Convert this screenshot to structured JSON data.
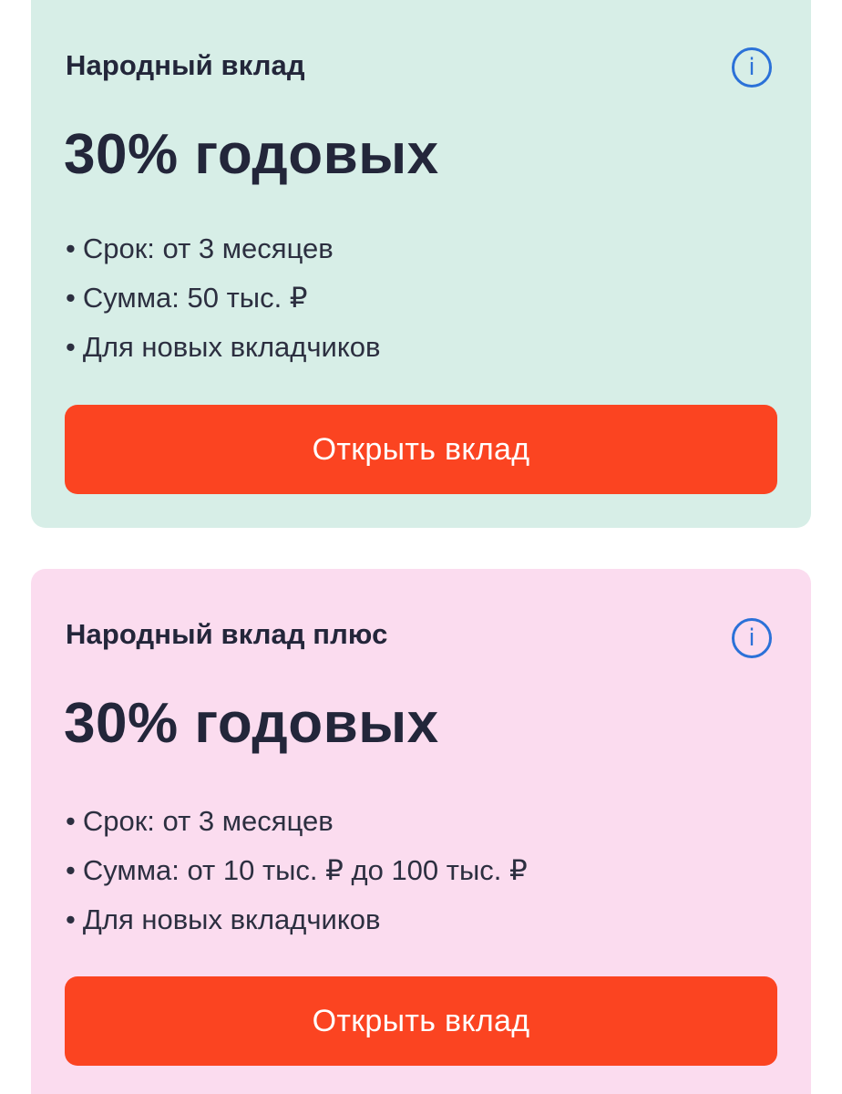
{
  "deposits": [
    {
      "title": "Народный вклад",
      "info_icon": "info-icon",
      "rate": "30% годовых",
      "features": [
        "Срок: от 3 месяцев",
        "Сумма: 50 тыс. ₽",
        "Для новых вкладчиков"
      ],
      "button_label": "Открыть вклад"
    },
    {
      "title": "Народный вклад плюс",
      "info_icon": "info-icon",
      "rate": "30% годовых",
      "features": [
        "Срок: от 3 месяцев",
        "Сумма: от 10 тыс. ₽ до 100 тыс. ₽",
        "Для новых вкладчиков"
      ],
      "button_label": "Открыть вклад"
    }
  ],
  "colors": {
    "card_1_background": "#d7eee7",
    "card_2_background": "#fbdcef",
    "button": "#fb4421",
    "info_icon": "#2b71d8",
    "text": "#23263a"
  }
}
